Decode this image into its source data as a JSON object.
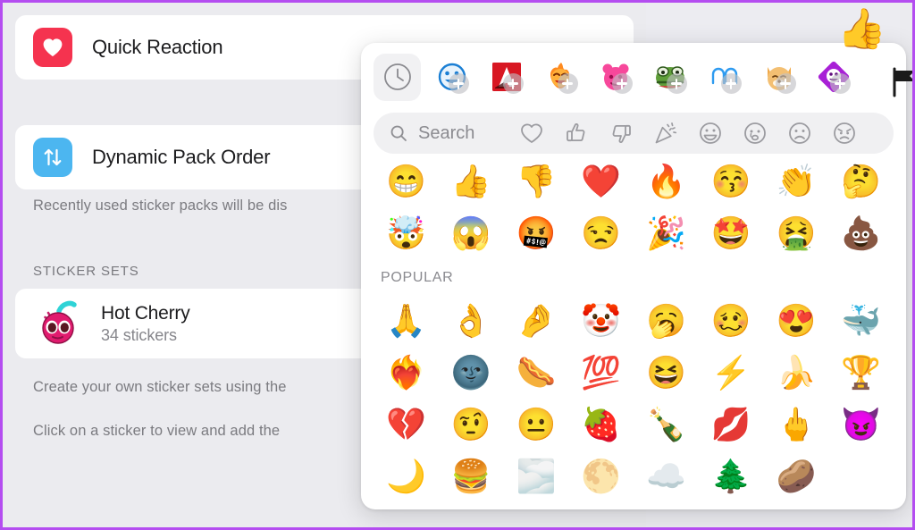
{
  "window": {
    "accent_border_color": "#b44df0",
    "background_color": "#ebebef"
  },
  "settings_panel": {
    "rows": [
      {
        "id": "quick-reaction",
        "label": "Quick Reaction",
        "icon": "heart-icon",
        "icon_bg": "#f5334f"
      },
      {
        "id": "dynamic-pack-order",
        "label": "Dynamic Pack Order",
        "icon": "sort-arrows-icon",
        "icon_bg": "#4cb6f0"
      }
    ],
    "dynamic_hint": "Recently used sticker packs will be dis",
    "section_title": "STICKER SETS",
    "sticker_sets": [
      {
        "name": "Hot Cherry",
        "count_label": "34 stickers",
        "icon": "cherry-sticker-icon"
      }
    ],
    "create_hint": "Create your own sticker sets using the",
    "click_hint": "Click on a sticker to view and add the"
  },
  "emoji_picker": {
    "pack_tabs": [
      {
        "id": "recents",
        "icon": "clock-icon",
        "selected": true,
        "has_add_badge": false,
        "glyph": ""
      },
      {
        "id": "pack-blue-smile",
        "icon": "blue-smiley-pack-icon",
        "selected": false,
        "has_add_badge": true,
        "glyph": "😀"
      },
      {
        "id": "pack-red-a",
        "icon": "red-a-pack-icon",
        "selected": false,
        "has_add_badge": true,
        "glyph": "A"
      },
      {
        "id": "pack-fire-face",
        "icon": "fire-face-pack-icon",
        "selected": false,
        "has_add_badge": true,
        "glyph": "😆"
      },
      {
        "id": "pack-pink-bear",
        "icon": "pink-bear-pack-icon",
        "selected": false,
        "has_add_badge": true,
        "glyph": "🐻"
      },
      {
        "id": "pack-pepe",
        "icon": "green-frog-pack-icon",
        "selected": false,
        "has_add_badge": true,
        "glyph": "🐸"
      },
      {
        "id": "pack-blue-outline",
        "icon": "blue-arch-pack-icon",
        "selected": false,
        "has_add_badge": true,
        "glyph": "◠◠"
      },
      {
        "id": "pack-shiba",
        "icon": "shiba-pack-icon",
        "selected": false,
        "has_add_badge": true,
        "glyph": "🐶"
      },
      {
        "id": "pack-purple-diamond",
        "icon": "purple-diamond-pack-icon",
        "selected": false,
        "has_add_badge": true,
        "glyph": "😄"
      }
    ],
    "search": {
      "placeholder": "Search",
      "icon": "search-icon",
      "quick_reactions": [
        {
          "id": "qr-heart",
          "icon": "heart-outline-icon"
        },
        {
          "id": "qr-thumbs-up",
          "icon": "thumbs-up-outline-icon"
        },
        {
          "id": "qr-thumbs-down",
          "icon": "thumbs-down-outline-icon"
        },
        {
          "id": "qr-party",
          "icon": "party-popper-outline-icon"
        },
        {
          "id": "qr-grin",
          "icon": "grinning-outline-icon"
        },
        {
          "id": "qr-cry",
          "icon": "crying-outline-icon"
        },
        {
          "id": "qr-frown",
          "icon": "frowning-outline-icon"
        },
        {
          "id": "qr-angry",
          "icon": "angry-outline-icon"
        }
      ]
    },
    "recents": {
      "emojis": [
        "😁",
        "👍",
        "👎",
        "❤️",
        "🔥",
        "😚",
        "👏",
        "🤔",
        "🤯",
        "😱",
        "🤬",
        "😒",
        "🎉",
        "🤩",
        "🤮",
        "💩"
      ]
    },
    "sections": [
      {
        "title": "POPULAR",
        "emojis": [
          "🙏",
          "👌",
          "🤌",
          "🤡",
          "🥱",
          "🥴",
          "😍",
          "🐳",
          "❤️‍🔥",
          "🌚",
          "🌭",
          "💯",
          "😆",
          "⚡",
          "🍌",
          "🏆",
          "💔",
          "🤨",
          "😐",
          "🍓",
          "🍾",
          "💋",
          "🖕",
          "😈",
          "🌙",
          "🍔",
          "🌫️",
          "🌕",
          "☁️",
          "🌲",
          "🥔"
        ]
      }
    ]
  },
  "decorations": {
    "stray_thumb": "👍",
    "edge_tab_icon": "flag-icon"
  }
}
